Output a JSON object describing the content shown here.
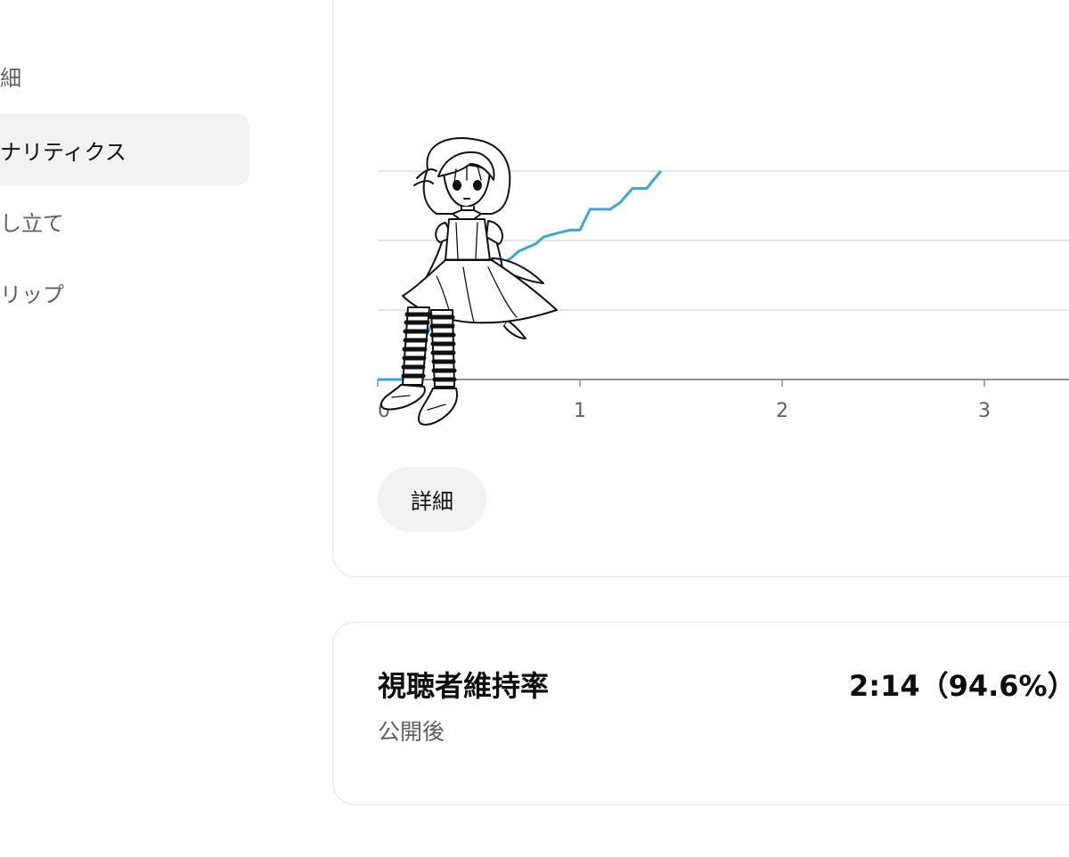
{
  "sidebar": {
    "items": [
      {
        "label": "細",
        "active": false
      },
      {
        "label": "ナリティクス",
        "active": true
      },
      {
        "label": "し立て",
        "active": false
      },
      {
        "label": "リップ",
        "active": false
      }
    ]
  },
  "chart_card": {
    "details_button": "詳細"
  },
  "retention": {
    "title": "視聴者維持率",
    "subtitle": "公開後",
    "value": "2:14（94.6%）"
  },
  "colors": {
    "line": "#3ea6d6",
    "grid": "#e5e5e5",
    "axis": "#909090",
    "active_bg": "#f2f2f2"
  },
  "illustration": {
    "icon": "seated-girl-illustration"
  },
  "chart_data": {
    "type": "line",
    "x_ticks": [
      "0",
      "1",
      "2",
      "3"
    ],
    "xlim": [
      0,
      3.4
    ],
    "ylim": [
      0,
      3
    ],
    "grid": true,
    "series": [
      {
        "x": [
          0,
          0.07,
          0.12,
          0.2,
          0.27,
          0.33,
          0.42,
          0.5,
          0.58,
          0.66,
          0.7,
          0.78,
          0.82,
          0.88,
          0.95,
          1.0,
          1.05,
          1.15,
          1.2,
          1.26,
          1.33,
          1.4
        ],
        "y": [
          0,
          0,
          0.0,
          0.4,
          0.8,
          1.05,
          1.3,
          1.45,
          1.6,
          1.75,
          1.85,
          1.95,
          2.05,
          2.1,
          2.15,
          2.15,
          2.45,
          2.45,
          2.55,
          2.75,
          2.75,
          3.0
        ]
      }
    ]
  }
}
